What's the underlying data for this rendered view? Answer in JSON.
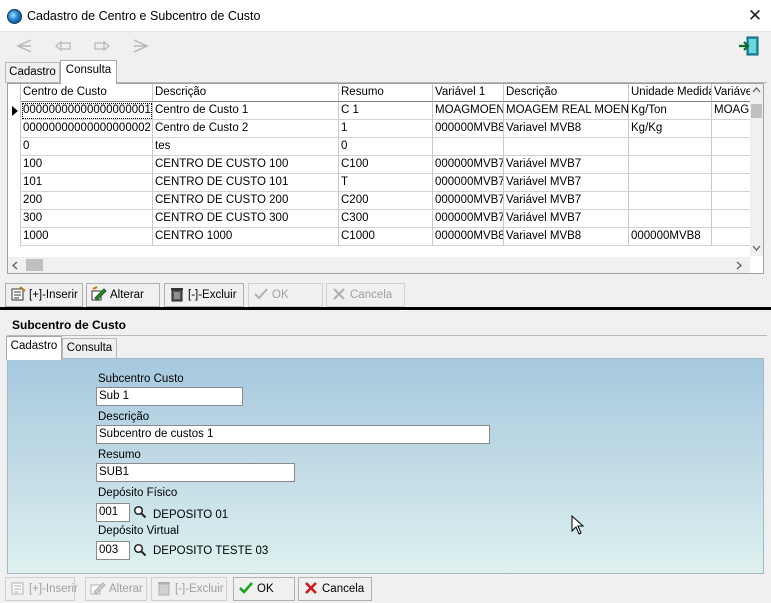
{
  "window": {
    "title": "Cadastro de Centro e Subcentro de Custo",
    "close": "✕"
  },
  "centro": {
    "tabs": [
      "Cadastro",
      "Consulta"
    ],
    "grid": {
      "columns": [
        "Centro de Custo",
        "Descrição",
        "Resumo",
        "Variável 1",
        "Descrição",
        "Unidade Medida",
        "Variável"
      ],
      "rows": [
        [
          "00000000000000000001",
          "Centro de Custo 1",
          "C 1",
          "MOAGMOEND",
          "MOAGEM REAL MOEND",
          "Kg/Ton",
          "MOAGM"
        ],
        [
          "00000000000000000002",
          "Centro de Custo 2",
          "1",
          "000000MVB8",
          "Variavel MVB8",
          "Kg/Kg",
          ""
        ],
        [
          "0",
          "tes",
          "0",
          "",
          "",
          "",
          ""
        ],
        [
          "100",
          "CENTRO DE CUSTO 100",
          "C100",
          "000000MVB7",
          "Variável MVB7",
          "",
          ""
        ],
        [
          "101",
          "CENTRO DE CUSTO 101",
          "T",
          "000000MVB7",
          "Variável MVB7",
          "",
          ""
        ],
        [
          "200",
          "CENTRO DE CUSTO 200",
          "C200",
          "000000MVB7",
          "Variável MVB7",
          "",
          ""
        ],
        [
          "300",
          "CENTRO DE CUSTO 300",
          "C300",
          "000000MVB7",
          "Variável MVB7",
          "",
          ""
        ],
        [
          "1000",
          "CENTRO 1000",
          "C1000",
          "000000MVB8",
          "Variavel MVB8",
          "000000MVB8",
          ""
        ]
      ]
    },
    "actions": {
      "insert": "[+]-Inserir",
      "edit": "Alterar",
      "delete": "[-]-Excluir",
      "ok": "OK",
      "cancel": "Cancela"
    }
  },
  "sub": {
    "title": "Subcentro de Custo",
    "tabs": [
      "Cadastro",
      "Consulta"
    ],
    "form": {
      "subcentro_label": "Subcentro Custo",
      "subcentro_value": "Sub 1",
      "descricao_label": "Descrição",
      "descricao_value": "Subcentro de custos 1",
      "resumo_label": "Resumo",
      "resumo_value": "SUB1",
      "dep_fisico_label": "Depósito Físico",
      "dep_fisico_code": "001",
      "dep_fisico_name": "DEPOSITO 01",
      "dep_virtual_label": "Depósito Virtual",
      "dep_virtual_code": "003",
      "dep_virtual_name": "DEPOSITO TESTE 03"
    },
    "actions": {
      "insert": "[+]-Inserir",
      "edit": "Alterar",
      "delete": "[-]-Excluir",
      "ok": "OK",
      "cancel": "Cancela"
    }
  }
}
